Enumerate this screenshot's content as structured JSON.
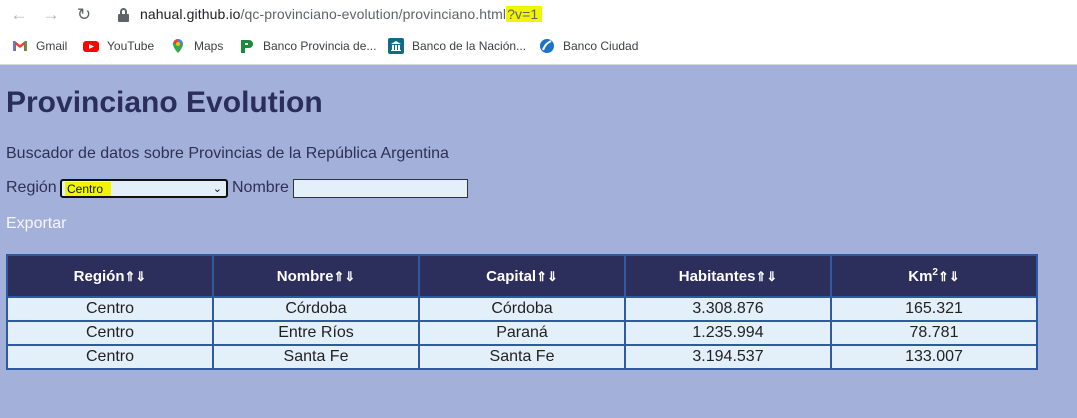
{
  "browser": {
    "url_host": "nahual.github.io",
    "url_path": "/qc-provinciano-evolution/provinciano.html",
    "url_query": "?v=1",
    "bookmarks": [
      {
        "label": "Gmail",
        "icon": "gmail-icon"
      },
      {
        "label": "YouTube",
        "icon": "youtube-icon"
      },
      {
        "label": "Maps",
        "icon": "maps-icon"
      },
      {
        "label": "Banco Provincia de...",
        "icon": "banco-provincia-icon"
      },
      {
        "label": "Banco de la Nación...",
        "icon": "banco-nacion-icon"
      },
      {
        "label": "Banco Ciudad",
        "icon": "banco-ciudad-icon"
      }
    ]
  },
  "page": {
    "title": "Provinciano Evolution",
    "subtitle": "Buscador de datos sobre Provincias de la República Argentina",
    "region_label": "Región",
    "region_value": "Centro",
    "name_label": "Nombre",
    "name_value": "",
    "export_label": "Exportar"
  },
  "table": {
    "headers": [
      "Región",
      "Nombre",
      "Capital",
      "Habitantes",
      "Km",
      "2"
    ],
    "sort_glyph": "⇑⇓",
    "rows": [
      [
        "Centro",
        "Córdoba",
        "Córdoba",
        "3.308.876",
        "165.321"
      ],
      [
        "Centro",
        "Entre Ríos",
        "Paraná",
        "1.235.994",
        "78.781"
      ],
      [
        "Centro",
        "Santa Fe",
        "Santa Fe",
        "3.194.537",
        "133.007"
      ]
    ]
  },
  "colors": {
    "page_background": "#a3b1da",
    "header_background": "#2c2e5c",
    "cell_background": "#e3eff9",
    "border": "#2f5aa0",
    "highlight": "#f1f500"
  }
}
